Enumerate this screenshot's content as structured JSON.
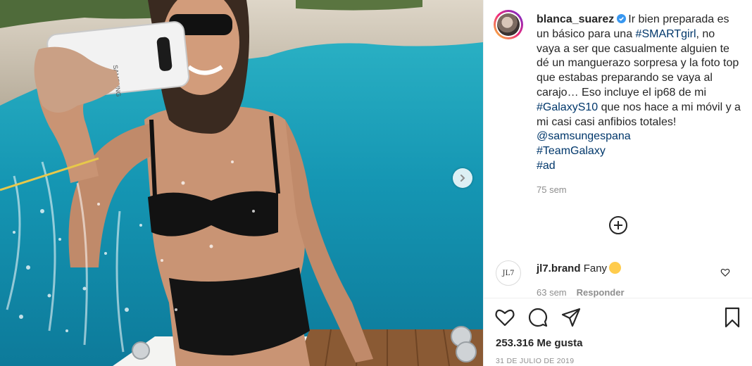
{
  "post": {
    "username": "blanca_suarez",
    "caption_pre": "Ir bien preparada es un básico para una ",
    "hashtag_smart": "#SMARTgirl",
    "caption_mid": ", no vaya a ser que casualmente alguien te dé un manguerazo sorpresa y la foto top que estabas preparando se vaya al carajo… Eso incluye el ip68 de mi ",
    "hashtag_galaxy": "#GalaxyS10",
    "caption_post": " que nos hace a mi móvil y a mi casi casi anfibios totales!",
    "mention": "@samsungespana",
    "hashtag_team": "#TeamGalaxy",
    "hashtag_ad": "#ad",
    "time": "75 sem"
  },
  "comment": {
    "avatar_text": "JL7",
    "username": "jl7.brand",
    "text": "Fany",
    "time": "63 sem",
    "reply": "Responder"
  },
  "footer": {
    "likes_count": "253.316",
    "likes_label": "Me gusta",
    "date": "31 DE JULIO DE 2019"
  },
  "phone_brand": "SAMSUNG",
  "icons": [
    "verified-badge-icon",
    "chevron-right-icon",
    "plus-circle-icon",
    "heart-icon",
    "comment-icon",
    "share-icon",
    "bookmark-icon"
  ],
  "colors": {
    "link": "#00376b",
    "meta": "#8e8e8e",
    "verified": "#3897f0",
    "water": "#1aa3b8"
  }
}
